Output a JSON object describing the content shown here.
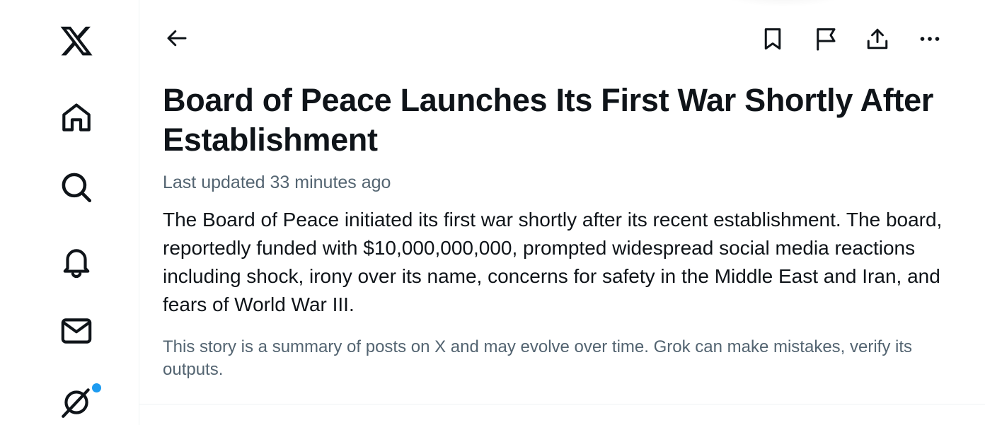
{
  "sidebar": {
    "items": [
      {
        "name": "x-logo",
        "icon": "x-logo-icon"
      },
      {
        "name": "home",
        "icon": "home-icon"
      },
      {
        "name": "explore",
        "icon": "search-icon"
      },
      {
        "name": "notifications",
        "icon": "bell-icon"
      },
      {
        "name": "messages",
        "icon": "mail-icon"
      },
      {
        "name": "grok",
        "icon": "grok-icon",
        "badge": true
      }
    ],
    "badge_color": "#1d9bf0"
  },
  "toolbar": {
    "back_icon": "arrow-left-icon",
    "actions": [
      "bookmark-icon",
      "flag-icon",
      "share-icon",
      "more-icon"
    ]
  },
  "story": {
    "title": "Board of Peace Launches Its First War Shortly After Establishment",
    "updated": "Last updated 33 minutes ago",
    "summary": "The Board of Peace initiated its first war shortly after its recent establishment. The board, reportedly funded with $10,000,000,000, prompted widespread social media reactions including shock, irony over its name, concerns for safety in the Middle East and Iran, and fears of World War III.",
    "disclaimer": "This story is a summary of posts on X and may evolve over time. Grok can make mistakes, verify its outputs."
  },
  "colors": {
    "text": "#0f1419",
    "secondary": "#536471",
    "border": "#eff3f4",
    "accent": "#1d9bf0"
  }
}
